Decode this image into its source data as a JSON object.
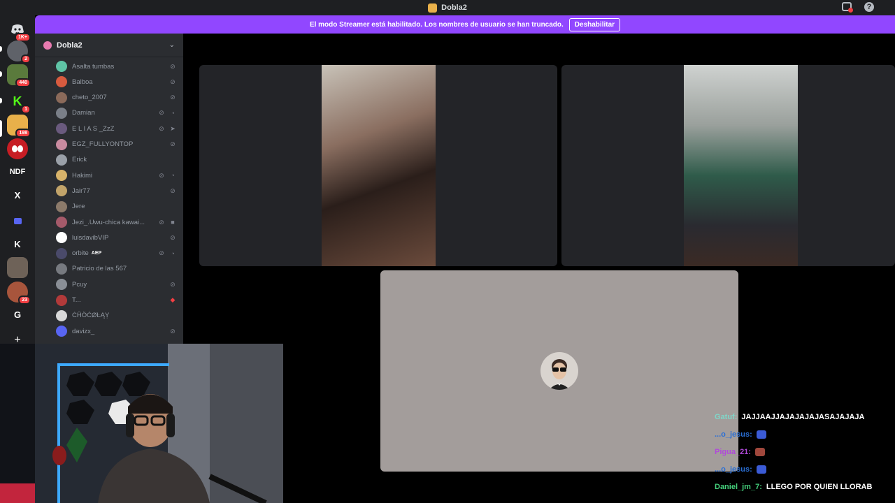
{
  "window": {
    "title": "Dobla2"
  },
  "banner": {
    "text": "El modo Streamer está habilitado. Los nombres de usuario se han truncado.",
    "button_label": "Deshabilitar"
  },
  "guilds": [
    {
      "label": "",
      "badge": "1K+"
    },
    {
      "label": "",
      "badge": "2"
    },
    {
      "label": "",
      "badge": "440"
    },
    {
      "label": "",
      "badge": "1"
    },
    {
      "label": "",
      "badge": "198"
    },
    {
      "label": "",
      "badge": ""
    },
    {
      "label": "NDF",
      "badge": ""
    },
    {
      "label": "X",
      "badge": ""
    },
    {
      "label": "",
      "badge": ""
    },
    {
      "label": "K",
      "badge": ""
    },
    {
      "label": "",
      "badge": ""
    },
    {
      "label": "",
      "badge": "23"
    },
    {
      "label": "G",
      "badge": ""
    },
    {
      "label": "+",
      "badge": ""
    }
  ],
  "server": {
    "name": "Dobla2",
    "chevron": "chevron-down-icon"
  },
  "members": [
    {
      "name": "Asalta tumbas",
      "tag": "",
      "icons": [
        "mic-muted-icon"
      ]
    },
    {
      "name": "Balboa",
      "tag": "",
      "icons": [
        "mic-muted-icon"
      ]
    },
    {
      "name": "cheto_2007",
      "tag": "",
      "icons": [
        "mic-muted-icon"
      ]
    },
    {
      "name": "Damian",
      "tag": "",
      "icons": [
        "mic-muted-icon",
        "deafened-icon"
      ]
    },
    {
      "name": "E L I A S _ZzZ",
      "tag": "",
      "icons": [
        "mic-muted-icon",
        "rocket-icon"
      ]
    },
    {
      "name": "EGZ_FULLYONTOP",
      "tag": "",
      "icons": [
        "mic-muted-icon"
      ]
    },
    {
      "name": "Erick",
      "tag": "",
      "icons": []
    },
    {
      "name": "Hakimi",
      "tag": "",
      "icons": [
        "mic-muted-icon",
        "deafened-icon"
      ]
    },
    {
      "name": "Jair77",
      "tag": "",
      "icons": [
        "mic-muted-icon"
      ]
    },
    {
      "name": "Jere",
      "tag": "",
      "icons": []
    },
    {
      "name": "Jezi_.Uwu-chica kawai...",
      "tag": "",
      "icons": [
        "mic-muted-icon",
        "camera-icon"
      ]
    },
    {
      "name": "luisdavibVIP",
      "tag": "",
      "icons": [
        "mic-muted-icon"
      ]
    },
    {
      "name": "orbite",
      "tag": "AEP",
      "icons": [
        "mic-muted-icon",
        "deafened-icon"
      ]
    },
    {
      "name": "Patricio de las 567",
      "tag": "",
      "icons": []
    },
    {
      "name": "Pcuy",
      "tag": "",
      "icons": [
        "mic-muted-icon"
      ]
    },
    {
      "name": "T...",
      "tag": "",
      "icons": [
        "red-mic-muted-icon"
      ]
    },
    {
      "name": "ĊĤÖĆØĿĄỴ",
      "tag": "",
      "icons": []
    },
    {
      "name": "davizx_",
      "tag": "",
      "icons": [
        "mic-muted-icon"
      ]
    }
  ],
  "chat": [
    {
      "user": "Gatuf:",
      "message": "JAJJAAJJAJAJAJAJASAJAJAJA",
      "color": "#7fd6c8"
    },
    {
      "user": "...o_jesus:",
      "message": "",
      "color": "#2a6fd6"
    },
    {
      "user": "Pigua_21:",
      "message": "",
      "color": "#b04ad9"
    },
    {
      "user": "...o_jesus:",
      "message": "",
      "color": "#2a6fd6"
    },
    {
      "user": "Daniel_jm_7:",
      "message": "LLEGO POR QUIEN LLORAB",
      "color": "#45d07c"
    }
  ],
  "colors": {
    "accent": "#9147ff",
    "sidebar_bg": "#2b2d31",
    "guild_bg": "#1e1f22",
    "notification_red": "#f23f43"
  }
}
